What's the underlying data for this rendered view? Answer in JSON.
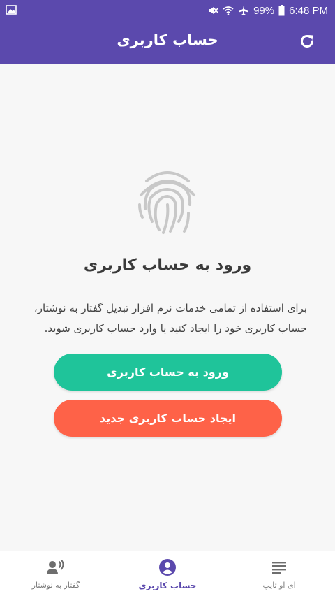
{
  "colors": {
    "primary": "#5b49ad",
    "login_button": "#1fc49a",
    "register_button": "#fe6248",
    "background": "#f7f7f7"
  },
  "status_bar": {
    "battery": "99%",
    "time": "6:48 PM",
    "icons": [
      "image-icon",
      "mute-icon",
      "wifi-icon",
      "airplane-icon",
      "battery-icon"
    ]
  },
  "app_bar": {
    "title": "حساب کاربری",
    "refresh_icon": "refresh-icon"
  },
  "main": {
    "icon": "fingerprint-icon",
    "headline": "ورود به حساب کاربری",
    "description": "برای استفاده از تمامی خدمات نرم افزار تبدیل گفتار به نوشتار، حساب کاربری خود را ایجاد کنید یا وارد حساب کاربری شوید.",
    "login_label": "ورود به حساب کاربری",
    "register_label": "ایجاد حساب کاربری جدید"
  },
  "bottom_nav": {
    "items": [
      {
        "label": "گفتار به نوشتار",
        "icon": "voice-icon",
        "active": false
      },
      {
        "label": "حساب کاربری",
        "icon": "account-icon",
        "active": true
      },
      {
        "label": "ای او تایپ",
        "icon": "list-icon",
        "active": false
      }
    ]
  }
}
